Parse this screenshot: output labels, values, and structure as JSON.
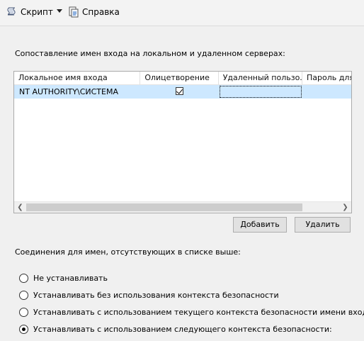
{
  "toolbar": {
    "script_label": "Скрипт",
    "help_label": "Справка"
  },
  "mapping": {
    "section_label": "Сопоставление имен входа на локальном и удаленном серверах:",
    "columns": [
      "Локальное имя входа",
      "Олицетворение",
      "Удаленный пользо...",
      "Пароль для"
    ],
    "rows": [
      {
        "local_login": "NT AUTHORITY\\СИСТЕМА",
        "impersonate": true,
        "remote_user": "",
        "password": ""
      }
    ],
    "add_button": "Добавить",
    "remove_button": "Удалить"
  },
  "connections": {
    "section_label": "Соединения для имен, отсутствующих в списке выше:",
    "options": [
      {
        "label": "Не устанавливать",
        "checked": false
      },
      {
        "label": "Устанавливать без использования контекста безопасности",
        "checked": false
      },
      {
        "label": "Устанавливать с использованием текущего контекста безопасности имени входа",
        "checked": false
      },
      {
        "label": "Устанавливать с использованием следующего контекста безопасности:",
        "checked": true
      }
    ]
  }
}
